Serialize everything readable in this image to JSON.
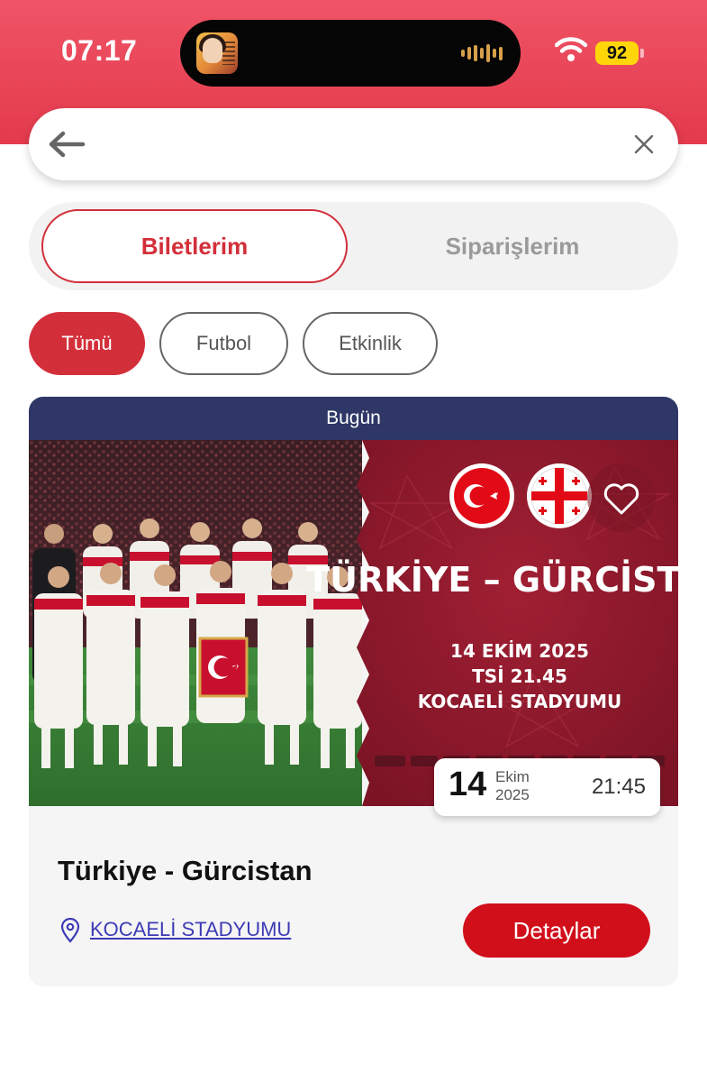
{
  "status_bar": {
    "time": "07:17",
    "battery": "92"
  },
  "header": {
    "search_value": ""
  },
  "segments": {
    "active": "Biletlerim",
    "inactive": "Siparişlerim"
  },
  "filters": [
    {
      "label": "Tümü",
      "selected": true
    },
    {
      "label": "Futbol",
      "selected": false
    },
    {
      "label": "Etkinlik",
      "selected": false
    }
  ],
  "ticket": {
    "badge": "Bugün",
    "poster": {
      "title": "TÜRKİYE – GÜRCİSTAN",
      "date": "14 EKİM 2025",
      "time": "TSİ 21.45",
      "venue": "KOCAELİ STADYUMU"
    },
    "date": {
      "day": "14",
      "month": "Ekim",
      "year": "2025",
      "time": "21:45"
    },
    "event_title": "Türkiye - Gürcistan",
    "venue": "KOCAELİ STADYUMU",
    "details_label": "Detaylar"
  },
  "colors": {
    "brand_red": "#d32f3a",
    "status_bar": "#e8475a",
    "header_navy": "#2e3766",
    "poster_bg": "#8e1a2c",
    "link": "#3d3bb5"
  }
}
